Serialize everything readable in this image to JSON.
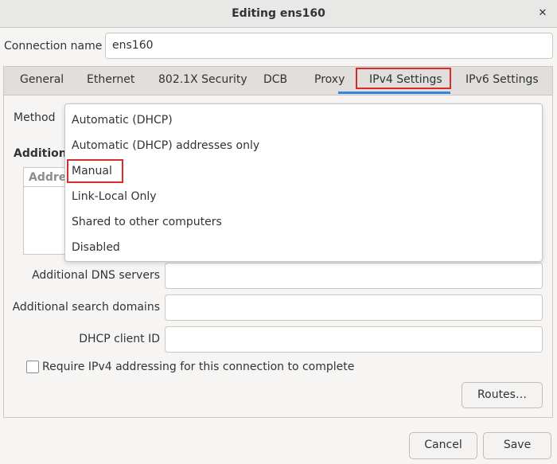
{
  "window": {
    "title": "Editing ens160",
    "close_glyph": "✕"
  },
  "connection": {
    "label": "Connection name",
    "value": "ens160"
  },
  "tabs": [
    {
      "label": "General"
    },
    {
      "label": "Ethernet"
    },
    {
      "label": "802.1X Security"
    },
    {
      "label": "DCB"
    },
    {
      "label": "Proxy"
    },
    {
      "label": "IPv4 Settings"
    },
    {
      "label": "IPv6 Settings"
    }
  ],
  "active_tab": "IPv4 Settings",
  "ipv4": {
    "method_label": "Method",
    "additional_heading": "Additional",
    "addresses_header": "Address",
    "dns_label": "Additional DNS servers",
    "dns_value": "",
    "search_label": "Additional search domains",
    "search_value": "",
    "dhcp_label": "DHCP client ID",
    "dhcp_value": "",
    "require_label": "Require IPv4 addressing for this connection to complete",
    "require_checked": false,
    "routes_button": "Routes…"
  },
  "method_options": [
    {
      "label": "Automatic (DHCP)"
    },
    {
      "label": "Automatic (DHCP) addresses only"
    },
    {
      "label": "Manual"
    },
    {
      "label": "Link-Local Only"
    },
    {
      "label": "Shared to other computers"
    },
    {
      "label": "Disabled"
    }
  ],
  "highlighted_option": "Manual",
  "footer": {
    "cancel": "Cancel",
    "save": "Save"
  },
  "colors": {
    "highlight_box": "#d62c2c",
    "active_tab_underline": "#3584e4"
  }
}
